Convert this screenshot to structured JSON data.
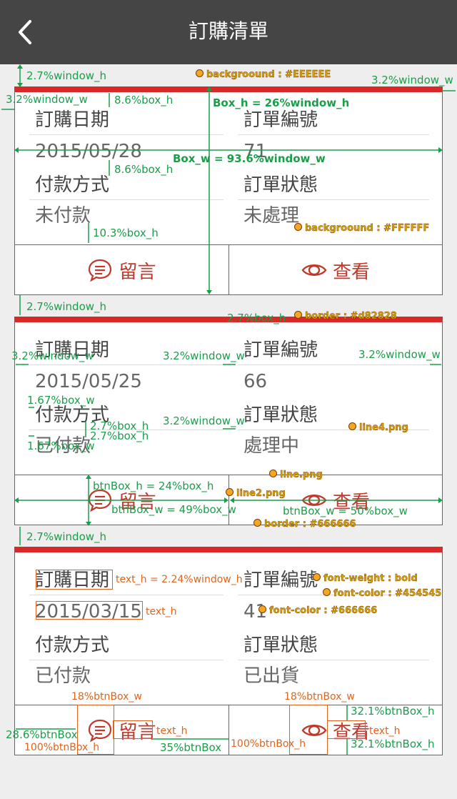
{
  "header": {
    "title": "訂購清單",
    "back_icon": "chevron-left-icon"
  },
  "labels": {
    "order_date": "訂購日期",
    "order_no": "訂單編號",
    "payment": "付款方式",
    "status": "訂單狀態"
  },
  "buttons": {
    "message": "留言",
    "view": "查看"
  },
  "orders": [
    {
      "date": "2015/05/28",
      "number": "71",
      "payment": "未付款",
      "status": "未處理"
    },
    {
      "date": "2015/05/25",
      "number": "66",
      "payment": "已付款",
      "status": "處理中"
    },
    {
      "date": "2015/03/15",
      "number": "41",
      "payment": "已付款",
      "status": "已出貨"
    }
  ],
  "colors": {
    "page_bg": "#EEEEEE",
    "box_bg": "#FFFFFF",
    "accent_border": "#d82828",
    "box_border": "#666666",
    "label_color": "#454545",
    "value_color": "#666666"
  },
  "annotations": {
    "a1": "2.7%window_h",
    "a2": "backgroound : #EEEEEE",
    "a3": "3.2%window_w",
    "a4": "3.2%window_w",
    "a5": "8.6%box_h",
    "a6": "Box_h = 26%window_h",
    "a7": "Box_w = 93.6%window_w",
    "a8": "8.6%box_h",
    "a9": "10.3%box_h",
    "a10": "backgroound : #FFFFFF",
    "a11": "2.7%window_h",
    "a12": "2.7%box_h",
    "a13": "border : #d82828",
    "a14": "3.2%window_w",
    "a15": "3.2%window_w",
    "a16": "3.2%window_w",
    "a17": "1.67%box_w",
    "a18": "2.7%box_h",
    "a19": "2.7%box_h",
    "a20": "3.2%window_w",
    "a21": "line4.png",
    "a22": "1.67%box_w",
    "a23": "line.png",
    "a24": "btnBox_h = 24%box_h",
    "a25": "line2.png",
    "a26": "btnBox_w = 49%box_w",
    "a27": "btnBox_w = 50%box_w",
    "a28": "border : #666666",
    "a29": "2.7%window_h",
    "a30": "text_h = 2.24%window_h",
    "a31": "text_h",
    "a32": "font-weight : bold",
    "a33": "font-color : #454545",
    "a34": "font-color : #666666",
    "a35": "18%btnBox_w",
    "a36": "18%btnBox_w",
    "a37": "32.1%btnBox_h",
    "a38": "28.6%btnBox",
    "a39": "text_h",
    "a40": "text_h",
    "a41": "100%btnBox_h",
    "a42": "35%btnBox",
    "a43": "100%btnBox_h",
    "a44": "32.1%btnBox_h"
  }
}
